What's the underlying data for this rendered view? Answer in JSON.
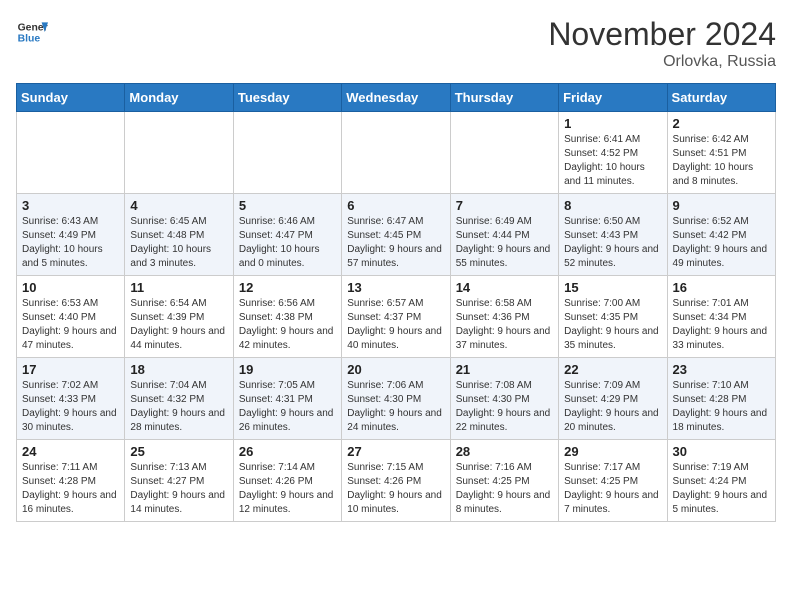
{
  "header": {
    "logo_line1": "General",
    "logo_line2": "Blue",
    "month_title": "November 2024",
    "location": "Orlovka, Russia"
  },
  "weekdays": [
    "Sunday",
    "Monday",
    "Tuesday",
    "Wednesday",
    "Thursday",
    "Friday",
    "Saturday"
  ],
  "weeks": [
    [
      {
        "day": "",
        "info": ""
      },
      {
        "day": "",
        "info": ""
      },
      {
        "day": "",
        "info": ""
      },
      {
        "day": "",
        "info": ""
      },
      {
        "day": "",
        "info": ""
      },
      {
        "day": "1",
        "info": "Sunrise: 6:41 AM\nSunset: 4:52 PM\nDaylight: 10 hours and 11 minutes."
      },
      {
        "day": "2",
        "info": "Sunrise: 6:42 AM\nSunset: 4:51 PM\nDaylight: 10 hours and 8 minutes."
      }
    ],
    [
      {
        "day": "3",
        "info": "Sunrise: 6:43 AM\nSunset: 4:49 PM\nDaylight: 10 hours and 5 minutes."
      },
      {
        "day": "4",
        "info": "Sunrise: 6:45 AM\nSunset: 4:48 PM\nDaylight: 10 hours and 3 minutes."
      },
      {
        "day": "5",
        "info": "Sunrise: 6:46 AM\nSunset: 4:47 PM\nDaylight: 10 hours and 0 minutes."
      },
      {
        "day": "6",
        "info": "Sunrise: 6:47 AM\nSunset: 4:45 PM\nDaylight: 9 hours and 57 minutes."
      },
      {
        "day": "7",
        "info": "Sunrise: 6:49 AM\nSunset: 4:44 PM\nDaylight: 9 hours and 55 minutes."
      },
      {
        "day": "8",
        "info": "Sunrise: 6:50 AM\nSunset: 4:43 PM\nDaylight: 9 hours and 52 minutes."
      },
      {
        "day": "9",
        "info": "Sunrise: 6:52 AM\nSunset: 4:42 PM\nDaylight: 9 hours and 49 minutes."
      }
    ],
    [
      {
        "day": "10",
        "info": "Sunrise: 6:53 AM\nSunset: 4:40 PM\nDaylight: 9 hours and 47 minutes."
      },
      {
        "day": "11",
        "info": "Sunrise: 6:54 AM\nSunset: 4:39 PM\nDaylight: 9 hours and 44 minutes."
      },
      {
        "day": "12",
        "info": "Sunrise: 6:56 AM\nSunset: 4:38 PM\nDaylight: 9 hours and 42 minutes."
      },
      {
        "day": "13",
        "info": "Sunrise: 6:57 AM\nSunset: 4:37 PM\nDaylight: 9 hours and 40 minutes."
      },
      {
        "day": "14",
        "info": "Sunrise: 6:58 AM\nSunset: 4:36 PM\nDaylight: 9 hours and 37 minutes."
      },
      {
        "day": "15",
        "info": "Sunrise: 7:00 AM\nSunset: 4:35 PM\nDaylight: 9 hours and 35 minutes."
      },
      {
        "day": "16",
        "info": "Sunrise: 7:01 AM\nSunset: 4:34 PM\nDaylight: 9 hours and 33 minutes."
      }
    ],
    [
      {
        "day": "17",
        "info": "Sunrise: 7:02 AM\nSunset: 4:33 PM\nDaylight: 9 hours and 30 minutes."
      },
      {
        "day": "18",
        "info": "Sunrise: 7:04 AM\nSunset: 4:32 PM\nDaylight: 9 hours and 28 minutes."
      },
      {
        "day": "19",
        "info": "Sunrise: 7:05 AM\nSunset: 4:31 PM\nDaylight: 9 hours and 26 minutes."
      },
      {
        "day": "20",
        "info": "Sunrise: 7:06 AM\nSunset: 4:30 PM\nDaylight: 9 hours and 24 minutes."
      },
      {
        "day": "21",
        "info": "Sunrise: 7:08 AM\nSunset: 4:30 PM\nDaylight: 9 hours and 22 minutes."
      },
      {
        "day": "22",
        "info": "Sunrise: 7:09 AM\nSunset: 4:29 PM\nDaylight: 9 hours and 20 minutes."
      },
      {
        "day": "23",
        "info": "Sunrise: 7:10 AM\nSunset: 4:28 PM\nDaylight: 9 hours and 18 minutes."
      }
    ],
    [
      {
        "day": "24",
        "info": "Sunrise: 7:11 AM\nSunset: 4:28 PM\nDaylight: 9 hours and 16 minutes."
      },
      {
        "day": "25",
        "info": "Sunrise: 7:13 AM\nSunset: 4:27 PM\nDaylight: 9 hours and 14 minutes."
      },
      {
        "day": "26",
        "info": "Sunrise: 7:14 AM\nSunset: 4:26 PM\nDaylight: 9 hours and 12 minutes."
      },
      {
        "day": "27",
        "info": "Sunrise: 7:15 AM\nSunset: 4:26 PM\nDaylight: 9 hours and 10 minutes."
      },
      {
        "day": "28",
        "info": "Sunrise: 7:16 AM\nSunset: 4:25 PM\nDaylight: 9 hours and 8 minutes."
      },
      {
        "day": "29",
        "info": "Sunrise: 7:17 AM\nSunset: 4:25 PM\nDaylight: 9 hours and 7 minutes."
      },
      {
        "day": "30",
        "info": "Sunrise: 7:19 AM\nSunset: 4:24 PM\nDaylight: 9 hours and 5 minutes."
      }
    ]
  ]
}
